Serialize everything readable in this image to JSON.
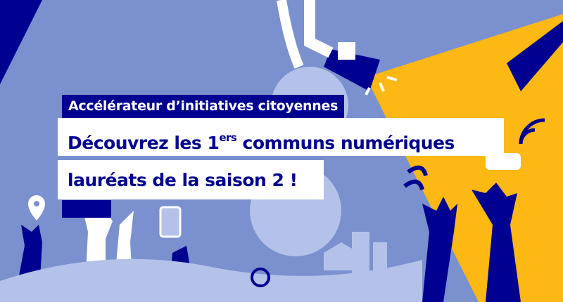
{
  "banner": {
    "label": "Accélérateur d’initiatives citoyennes",
    "title_line1_prefix": "Découvrez les 1",
    "title_line1_sup": "ers",
    "title_line1_suffix": " communs numériques",
    "title_line2": "lauréats de la saison 2 !"
  },
  "colors": {
    "background": "#7a90cf",
    "navy": "#000091",
    "yellow": "#fdb813",
    "light": "#b4c2ea"
  }
}
